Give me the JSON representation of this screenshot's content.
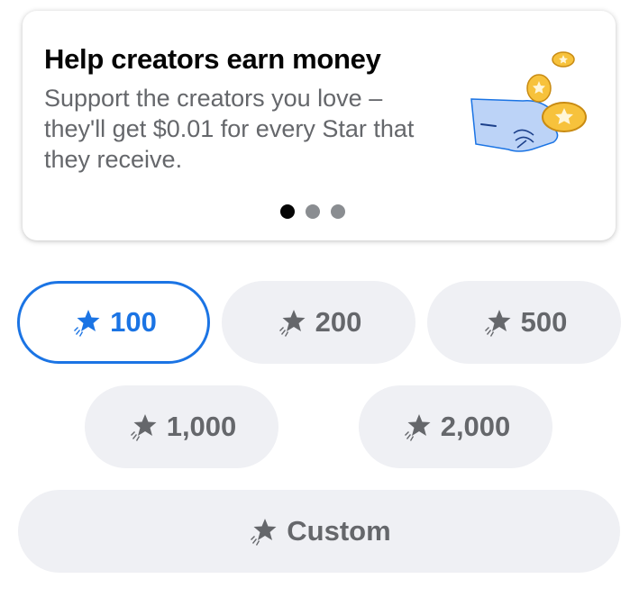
{
  "card": {
    "title": "Help creators earn money",
    "description": "Support the creators you love – they'll get $0.01 for every Star that they receive.",
    "pages": 3,
    "active_page": 1
  },
  "options": [
    {
      "label": "100",
      "selected": true
    },
    {
      "label": "200",
      "selected": false
    },
    {
      "label": "500",
      "selected": false
    },
    {
      "label": "1,000",
      "selected": false
    },
    {
      "label": "2,000",
      "selected": false
    },
    {
      "label": "Custom",
      "selected": false
    }
  ],
  "colors": {
    "accent": "#1b74e4",
    "pill_bg": "#eff0f4",
    "text_secondary": "#65676b"
  },
  "icons": {
    "option": "star-icon",
    "illustration": "hand-with-coins"
  }
}
